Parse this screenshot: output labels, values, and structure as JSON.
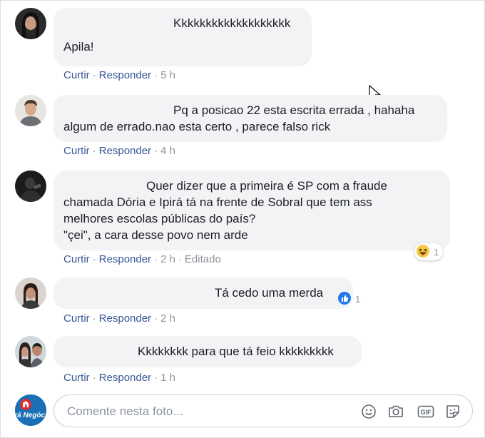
{
  "comments": [
    {
      "lines": [
        "Kkkkkkkkkkkkkkkkkkk",
        "Apila!"
      ],
      "actions": {
        "like": "Curtir",
        "reply": "Responder",
        "time": "5 h"
      }
    },
    {
      "lines": [
        "Pq a posicao 22 esta escrita errada , hahaha",
        "algum de errado.nao esta certo , parece falso rick"
      ],
      "actions": {
        "like": "Curtir",
        "reply": "Responder",
        "time": "4 h"
      }
    },
    {
      "lines": [
        "Quer dizer que a primeira é SP com a fraude",
        "chamada Dória e Ipirá tá na frente de Sobral que tem ass",
        "melhores escolas públicas do país?",
        "\"çei\", a cara desse povo nem arde"
      ],
      "actions": {
        "like": "Curtir",
        "reply": "Responder",
        "time": "2 h",
        "edited": "Editado"
      },
      "reaction": {
        "icon": "haha-emoji-icon",
        "count": "1"
      }
    },
    {
      "lines": [
        "Tá cedo uma merda"
      ],
      "actions": {
        "like": "Curtir",
        "reply": "Responder",
        "time": "2 h"
      },
      "reaction": {
        "icon": "like-thumb-icon",
        "count": "1"
      }
    },
    {
      "lines": [
        "Kkkkkkkk para que tá feio kkkkkkkkk"
      ],
      "actions": {
        "like": "Curtir",
        "reply": "Responder",
        "time": "1 h"
      }
    }
  ],
  "composer": {
    "placeholder": "Comente nesta foto...",
    "avatar_text": "Ipirá Negócios",
    "icons": [
      "smiley-icon",
      "camera-icon",
      "gif-icon",
      "sticker-icon"
    ]
  },
  "colors": {
    "link": "#385898",
    "meta": "#90949c",
    "bubble": "#f2f3f5",
    "like_blue": "#2078f4",
    "haha_yellow": "#f7c948"
  }
}
